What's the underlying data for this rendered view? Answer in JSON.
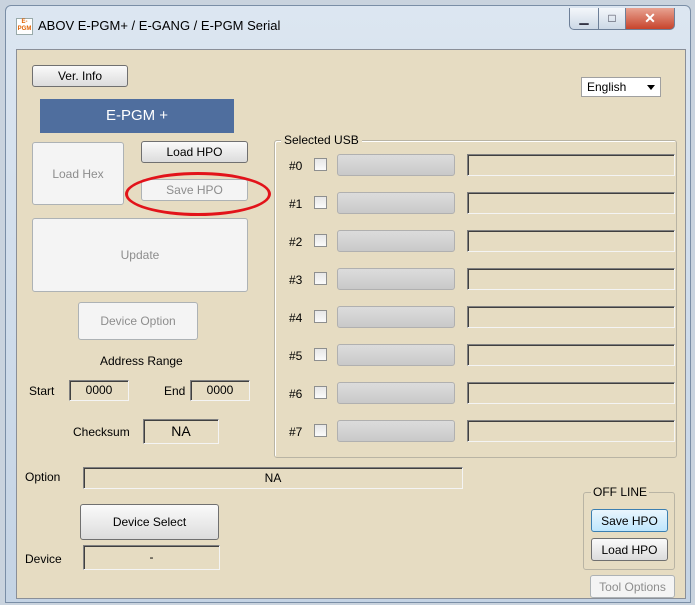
{
  "window": {
    "title": "ABOV E-PGM+ / E-GANG / E-PGM Serial",
    "app_icon_text": "E-PGM",
    "minimize_glyph": "▁",
    "maximize_glyph": "□",
    "close_glyph": "✕"
  },
  "toolbar": {
    "ver_info": "Ver. Info",
    "language": "English"
  },
  "brand": "E-PGM +",
  "actions": {
    "load_hex": "Load Hex",
    "load_hpo": "Load HPO",
    "save_hpo": "Save HPO",
    "update": "Update",
    "device_option": "Device Option"
  },
  "address": {
    "title": "Address Range",
    "start_label": "Start",
    "start_value": "0000",
    "end_label": "End",
    "end_value": "0000"
  },
  "checksum": {
    "label": "Checksum",
    "value": "NA"
  },
  "usb": {
    "title": "Selected USB",
    "rows": [
      {
        "label": "#0"
      },
      {
        "label": "#1"
      },
      {
        "label": "#2"
      },
      {
        "label": "#3"
      },
      {
        "label": "#4"
      },
      {
        "label": "#5"
      },
      {
        "label": "#6"
      },
      {
        "label": "#7"
      }
    ]
  },
  "option": {
    "label": "Option",
    "value": "NA"
  },
  "device": {
    "select_label": "Device Select",
    "label": "Device",
    "value": "-"
  },
  "offline": {
    "title": "OFF LINE",
    "save_hpo": "Save HPO",
    "load_hpo": "Load HPO"
  },
  "tool_options": "Tool Options",
  "colors": {
    "client_bg": "#e6dcc2",
    "brand_bg": "#4f6e9e",
    "annotation": "#e2131a"
  }
}
